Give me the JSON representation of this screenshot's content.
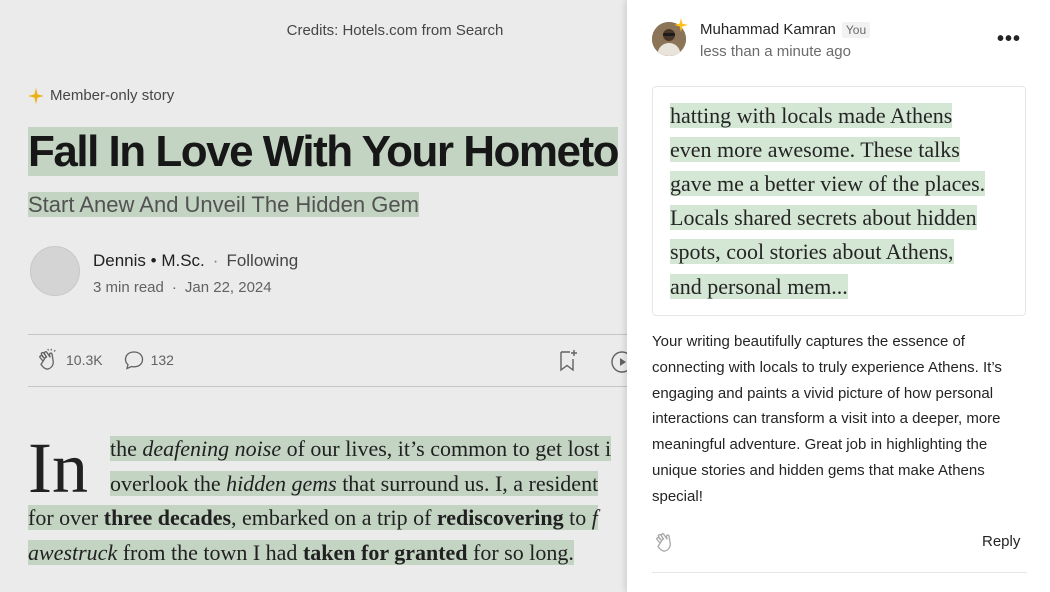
{
  "article": {
    "credits": "Credits: Hotels.com from Search",
    "member_label": "Member-only story",
    "title": "Fall In Love With Your Hometo",
    "subtitle": "Start Anew And Unveil The Hidden Gem",
    "author": {
      "name": "Dennis • M.Sc.",
      "separator": "·",
      "follow_status": "Following",
      "read_time": "3 min read",
      "meta_sep": "·",
      "date": "Jan 22, 2024"
    },
    "actions": {
      "claps": "10.3K",
      "comments": "132"
    },
    "body": {
      "dropcap": "In",
      "lines": [
        [
          {
            "t": "the ",
            "s": "n"
          },
          {
            "t": "deafening noise",
            "s": "i"
          },
          {
            "t": " of our lives, it’s common to get lost i",
            "s": "n"
          }
        ],
        [
          {
            "t": "overlook the ",
            "s": "n"
          },
          {
            "t": "hidden gems",
            "s": "i"
          },
          {
            "t": " that surround us. I, a resident",
            "s": "n"
          }
        ],
        [
          {
            "t": "for over ",
            "s": "n"
          },
          {
            "t": "three decades",
            "s": "b"
          },
          {
            "t": ", embarked on a trip of ",
            "s": "n"
          },
          {
            "t": "rediscovering",
            "s": "b"
          },
          {
            "t": " to ",
            "s": "n"
          },
          {
            "t": "f",
            "s": "i"
          }
        ],
        [
          {
            "t": "awestruck",
            "s": "i"
          },
          {
            "t": " from the town I had ",
            "s": "n"
          },
          {
            "t": "taken for granted",
            "s": "b"
          },
          {
            "t": " for so long.",
            "s": "n"
          }
        ]
      ]
    }
  },
  "comment": {
    "user_name": "Muhammad Kamran",
    "you_badge": "You",
    "time": "less than a minute ago",
    "more_icon": "•••",
    "quote_lines": [
      "hatting with locals made Athens",
      "even more awesome. These talks",
      "gave me a better view of the places.",
      "Locals shared secrets about hidden",
      "spots, cool stories about Athens,",
      "and personal mem..."
    ],
    "text_lines": [
      "Your writing beautifully captures the essence of",
      "connecting with locals to truly experience Athens. It’s",
      "engaging and paints a vivid picture of how personal",
      "interactions can transform a visit into a deeper, more",
      "meaningful adventure. Great job in highlighting the",
      "unique stories and hidden gems that make Athens",
      "special!"
    ],
    "reply_label": "Reply"
  },
  "colors": {
    "highlight": "#d4e6d4",
    "member_star": "#ffc017",
    "text": "#242424",
    "muted": "#6b6b6b"
  },
  "icons": [
    "star-icon",
    "clap-icon",
    "comment-icon",
    "bookmark-add-icon",
    "play-icon",
    "more-icon"
  ]
}
